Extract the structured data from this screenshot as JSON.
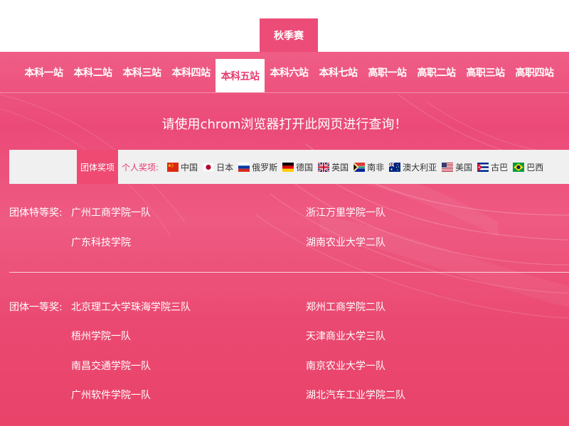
{
  "season_tab": "秋季赛",
  "nav": {
    "items": [
      "本科一站",
      "本科二站",
      "本科三站",
      "本科四站",
      "本科五站",
      "本科六站",
      "本科七站",
      "高职一站",
      "高职二站",
      "高职三站",
      "高职四站"
    ],
    "active_index": 4
  },
  "notice": "请使用chrom浏览器打开此网页进行查询！",
  "filter": {
    "team_award_tab": "团体奖项",
    "personal_label": "个人奖项:",
    "countries": [
      {
        "name": "中国",
        "flag": "china-flag-icon"
      },
      {
        "name": "日本",
        "flag": "japan-flag-icon"
      },
      {
        "name": "俄罗斯",
        "flag": "russia-flag-icon"
      },
      {
        "name": "德国",
        "flag": "germany-flag-icon"
      },
      {
        "name": "英国",
        "flag": "uk-flag-icon"
      },
      {
        "name": "南非",
        "flag": "south-africa-flag-icon"
      },
      {
        "name": "澳大利亚",
        "flag": "australia-flag-icon"
      },
      {
        "name": "美国",
        "flag": "usa-flag-icon"
      },
      {
        "name": "古巴",
        "flag": "cuba-flag-icon"
      },
      {
        "name": "巴西",
        "flag": "brazil-flag-icon"
      }
    ]
  },
  "awards": [
    {
      "label": "团体特等奖:",
      "teams": [
        "广州工商学院一队",
        "浙江万里学院一队",
        "广东科技学院",
        "湖南农业大学二队"
      ]
    },
    {
      "label": "团体一等奖:",
      "teams": [
        "北京理工大学珠海学院三队",
        "郑州工商学院二队",
        "梧州学院一队",
        "天津商业大学三队",
        "南昌交通学院一队",
        "南京农业大学一队",
        "广州软件学院一队",
        "湖北汽车工业学院二队"
      ]
    }
  ],
  "colors": {
    "accent": "#ec4c78",
    "active_text": "#e63b6e",
    "filter_bg": "#f0f0f0"
  }
}
